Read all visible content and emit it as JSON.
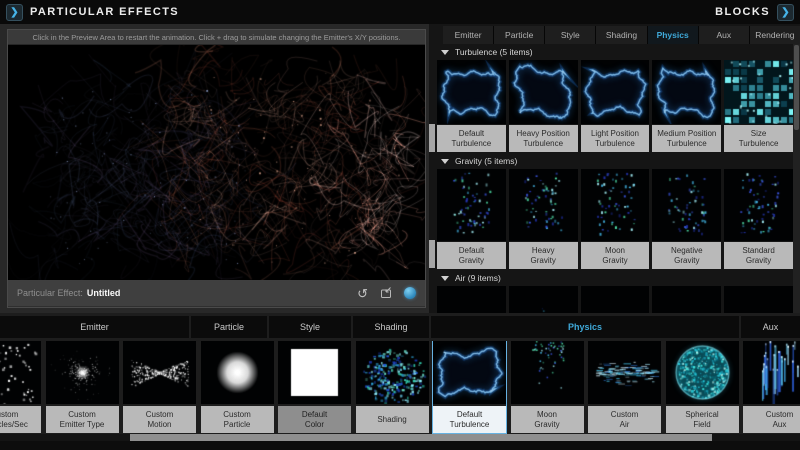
{
  "accent": "#3fa9d9",
  "selected_border": "#66b2e2",
  "label_bg": "#b9b9b9",
  "topbar": {
    "left_title": "PARTICULAR EFFECTS",
    "right_title": "BLOCKS",
    "left_chevron_icon": "chevron-right-icon",
    "right_chevron_icon": "chevron-right-icon"
  },
  "preview": {
    "hint": "Click in the Preview Area to restart the animation. Click + drag to simulate changing the Emitter's X/Y positions.",
    "effect_label": "Particular Effect:",
    "effect_name": "Untitled",
    "icons": [
      "reset-icon",
      "save-preset-icon",
      "help-icon"
    ]
  },
  "blocks_panel": {
    "tabs": [
      {
        "label": "Emitter"
      },
      {
        "label": "Particle"
      },
      {
        "label": "Style"
      },
      {
        "label": "Shading"
      },
      {
        "label": "Physics",
        "active": true
      },
      {
        "label": "Aux"
      },
      {
        "label": "Rendering"
      }
    ],
    "sections": [
      {
        "title": "Turbulence",
        "count": "(5 items)",
        "thumb_h": 64,
        "items": [
          {
            "label": "Default\nTurbulence",
            "viz": "turb",
            "seed": 11
          },
          {
            "label": "Heavy Position\nTurbulence",
            "viz": "turb",
            "seed": 12
          },
          {
            "label": "Light Position\nTurbulence",
            "viz": "turb",
            "seed": 13
          },
          {
            "label": "Medium Position\nTurbulence",
            "viz": "turb",
            "seed": 14
          },
          {
            "label": "Size\nTurbulence",
            "viz": "turbsize",
            "seed": 15
          }
        ]
      },
      {
        "title": "Gravity",
        "count": "(5 items)",
        "thumb_h": 72,
        "items": [
          {
            "label": "Default\nGravity",
            "viz": "grav",
            "seed": 21
          },
          {
            "label": "Heavy\nGravity",
            "viz": "grav",
            "seed": 22
          },
          {
            "label": "Moon\nGravity",
            "viz": "grav",
            "seed": 23
          },
          {
            "label": "Negative\nGravity",
            "viz": "grav",
            "seed": 24
          },
          {
            "label": "Standard\nGravity",
            "viz": "grav",
            "seed": 25
          }
        ]
      },
      {
        "title": "Air",
        "count": "(9 items)",
        "thumb_h": 64,
        "items": [
          {
            "viz": "air",
            "seed": 31
          },
          {
            "viz": "airburst",
            "seed": 32
          },
          {
            "viz": "air",
            "seed": 33
          },
          {
            "viz": "airthin",
            "seed": 34
          },
          {
            "viz": "air",
            "seed": 35
          }
        ]
      }
    ]
  },
  "bottom_strip": {
    "groups": [
      {
        "label": "Emitter"
      },
      {
        "label": "Particle"
      },
      {
        "label": "Style"
      },
      {
        "label": "Shading"
      },
      {
        "label": "Physics",
        "active": true
      },
      {
        "label": "Aux"
      }
    ],
    "items": [
      {
        "label": "Custom\nParticles/Sec",
        "viz": "scatter",
        "seed": 41
      },
      {
        "label": "Custom\nEmitter Type",
        "viz": "radial",
        "seed": 42
      },
      {
        "label": "Custom\nMotion",
        "viz": "bowtie",
        "seed": 43
      },
      {
        "label": "Custom\nParticle",
        "viz": "blob",
        "seed": 44
      },
      {
        "label": "Default\nColor",
        "viz": "whitesq",
        "seed": 45,
        "state": "dim"
      },
      {
        "label": "Shading",
        "viz": "burst",
        "seed": 46
      },
      {
        "label": "Default\nTurbulence",
        "viz": "turb",
        "seed": 47,
        "state": "selected"
      },
      {
        "label": "Moon\nGravity",
        "viz": "fall",
        "seed": 48
      },
      {
        "label": "Custom\nAir",
        "viz": "streakh",
        "seed": 49
      },
      {
        "label": "Spherical\nField",
        "viz": "sphere",
        "seed": 50
      },
      {
        "label": "Custom\nAux",
        "viz": "streakv",
        "seed": 51
      }
    ]
  }
}
